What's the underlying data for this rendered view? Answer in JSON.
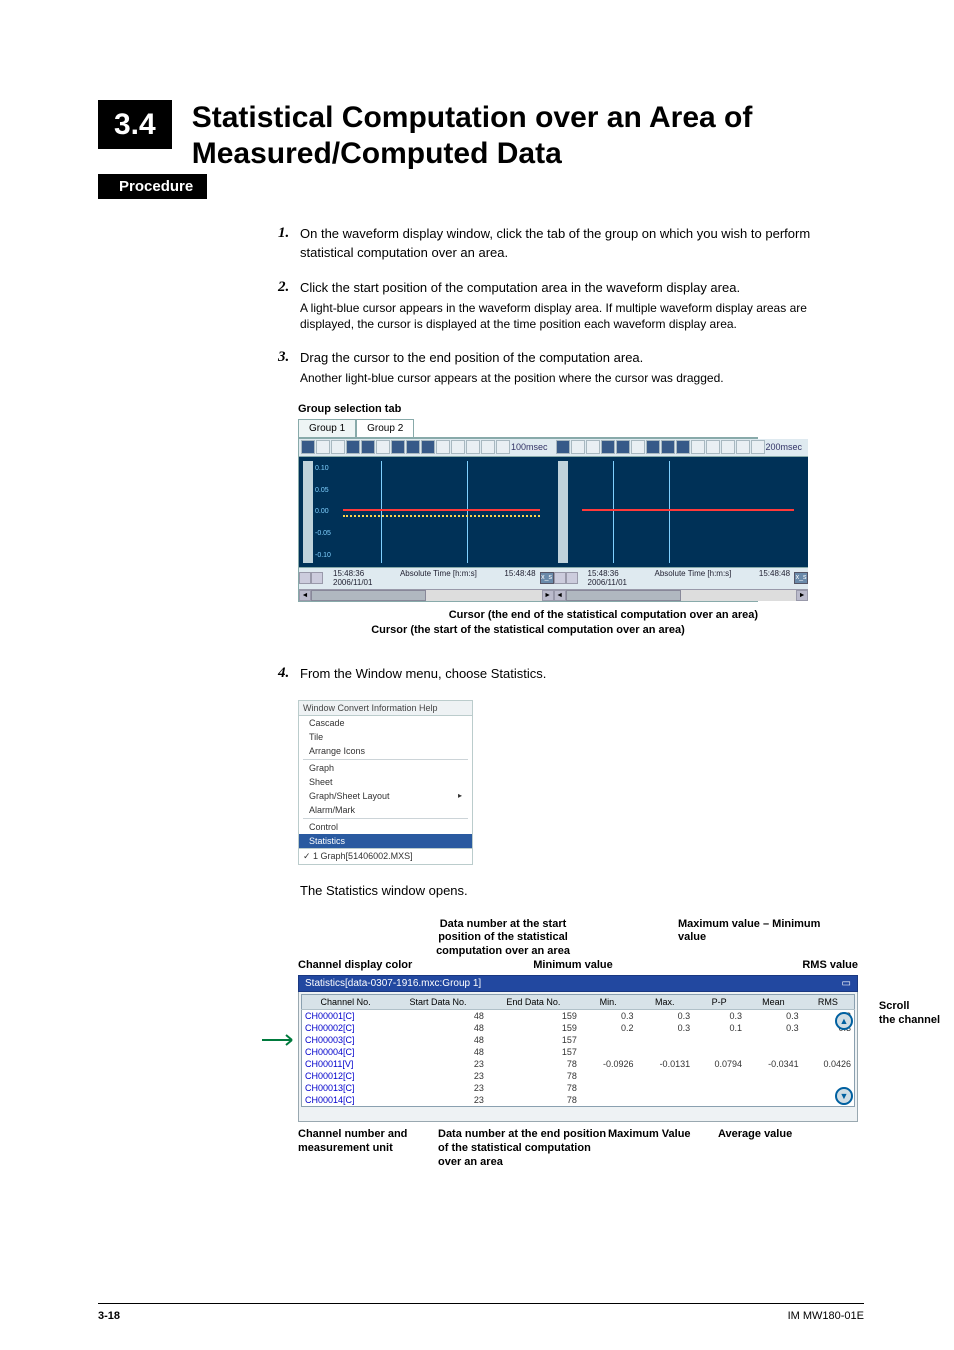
{
  "header": {
    "section_number": "3.4",
    "title": "Statistical Computation over an Area of Measured/Computed Data",
    "procedure_label": "Procedure"
  },
  "steps": {
    "s1": {
      "n": "1.",
      "main": "On the waveform display window, click the tab of the group on which you wish to perform statistical computation over an area."
    },
    "s2": {
      "n": "2.",
      "main": "Click the start position of the computation area in the waveform display area.",
      "sub": "A light-blue cursor appears in the waveform display area. If multiple waveform display areas are displayed, the cursor is displayed at the time position each waveform display area."
    },
    "s3": {
      "n": "3.",
      "main": "Drag the cursor to the end position of the computation area.",
      "sub": "Another light-blue cursor appears at the position where the cursor was dragged."
    },
    "s4": {
      "n": "4.",
      "main": "From the Window menu, choose Statistics."
    }
  },
  "fig1": {
    "label": "Group selection tab",
    "tabs": [
      "Group 1",
      "Group 2"
    ],
    "left_rate": "100msec",
    "right_rate": "200msec",
    "yticks": [
      "0.10",
      "0.05",
      "0.00",
      "-0.05",
      "-0.10"
    ],
    "time1": "15:48:36",
    "time2": "15:48:48",
    "date": "2006/11/01",
    "xlabel": "Absolute Time [h:m:s]",
    "xend": "x_s",
    "caption1": "Cursor (the end of the statistical computation over an area)",
    "caption2": "Cursor (the start of the statistical computation over an area)"
  },
  "fig2": {
    "menubar": "Window  Convert  Information  Help",
    "items1": [
      "Cascade",
      "Tile",
      "Arrange Icons"
    ],
    "items2": [
      "Graph",
      "Sheet",
      "Graph/Sheet Layout",
      "Alarm/Mark"
    ],
    "items3": [
      "Control",
      "Statistics"
    ],
    "status": "✓ 1 Graph[51406002.MXS]",
    "followup": "The Statistics window opens."
  },
  "fig3": {
    "top_annots": {
      "channel_color": "Channel display color",
      "data_start": "Data number at the start position of the statistical computation over an area",
      "min_value": "Minimum value",
      "max_minus_min": "Maximum value – Minimum value",
      "rms_value": "RMS value"
    },
    "window_title": "Statistics[data-0307-1916.mxc:Group 1]",
    "headers": [
      "Channel No.",
      "Start Data No.",
      "End Data No.",
      "Min.",
      "Max.",
      "P-P",
      "Mean",
      "RMS"
    ],
    "rows": [
      {
        "ch": "CH00001[C]",
        "s": "48",
        "e": "159",
        "min": "0.3",
        "max": "0.3",
        "pp": "0.3",
        "mean": "0.3",
        "rms": "0.3"
      },
      {
        "ch": "CH00002[C]",
        "s": "48",
        "e": "159",
        "min": "0.2",
        "max": "0.3",
        "pp": "0.1",
        "mean": "0.3",
        "rms": "0.3"
      },
      {
        "ch": "CH00003[C]",
        "s": "48",
        "e": "157",
        "min": "",
        "max": "",
        "pp": "",
        "mean": "",
        "rms": ""
      },
      {
        "ch": "CH00004[C]",
        "s": "48",
        "e": "157",
        "min": "",
        "max": "",
        "pp": "",
        "mean": "",
        "rms": ""
      },
      {
        "ch": "CH00011[V]",
        "s": "23",
        "e": "78",
        "min": "-0.0926",
        "max": "-0.0131",
        "pp": "0.0794",
        "mean": "-0.0341",
        "rms": "0.0426"
      },
      {
        "ch": "CH00012[C]",
        "s": "23",
        "e": "78",
        "min": "",
        "max": "",
        "pp": "",
        "mean": "",
        "rms": ""
      },
      {
        "ch": "CH00013[C]",
        "s": "23",
        "e": "78",
        "min": "",
        "max": "",
        "pp": "",
        "mean": "",
        "rms": ""
      },
      {
        "ch": "CH00014[C]",
        "s": "23",
        "e": "78",
        "min": "",
        "max": "",
        "pp": "",
        "mean": "",
        "rms": ""
      }
    ],
    "right_annots": {
      "scroll": "Scroll",
      "the_channel": "the channel"
    },
    "bottom_annots": {
      "channel_num": "Channel number and measurement unit",
      "data_end": "Data number at the end position of the statistical computation over an area",
      "max_value": "Maximum Value",
      "avg_value": "Average value"
    }
  },
  "footer": {
    "page": "3-18",
    "doc": "IM MW180-01E"
  }
}
